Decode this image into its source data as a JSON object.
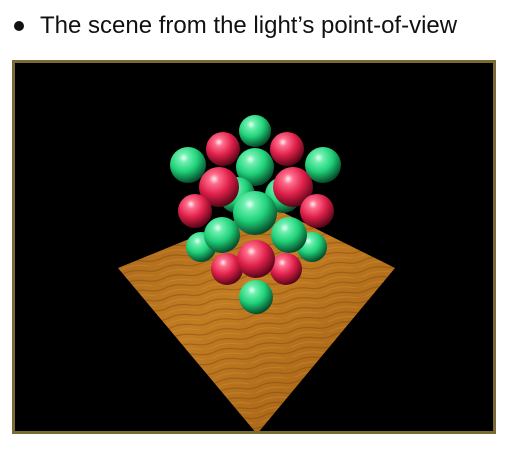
{
  "slide": {
    "bullet_text": "The scene from the light’s point-of-view"
  },
  "render": {
    "background_color": "#000000",
    "frame_color": "#7a6b35",
    "floor": {
      "material": "wood",
      "base_color": "#b8741a",
      "grain_color": "#8a5410"
    },
    "spheres": {
      "green_color": "#20d27a",
      "red_color": "#e0204a"
    }
  }
}
